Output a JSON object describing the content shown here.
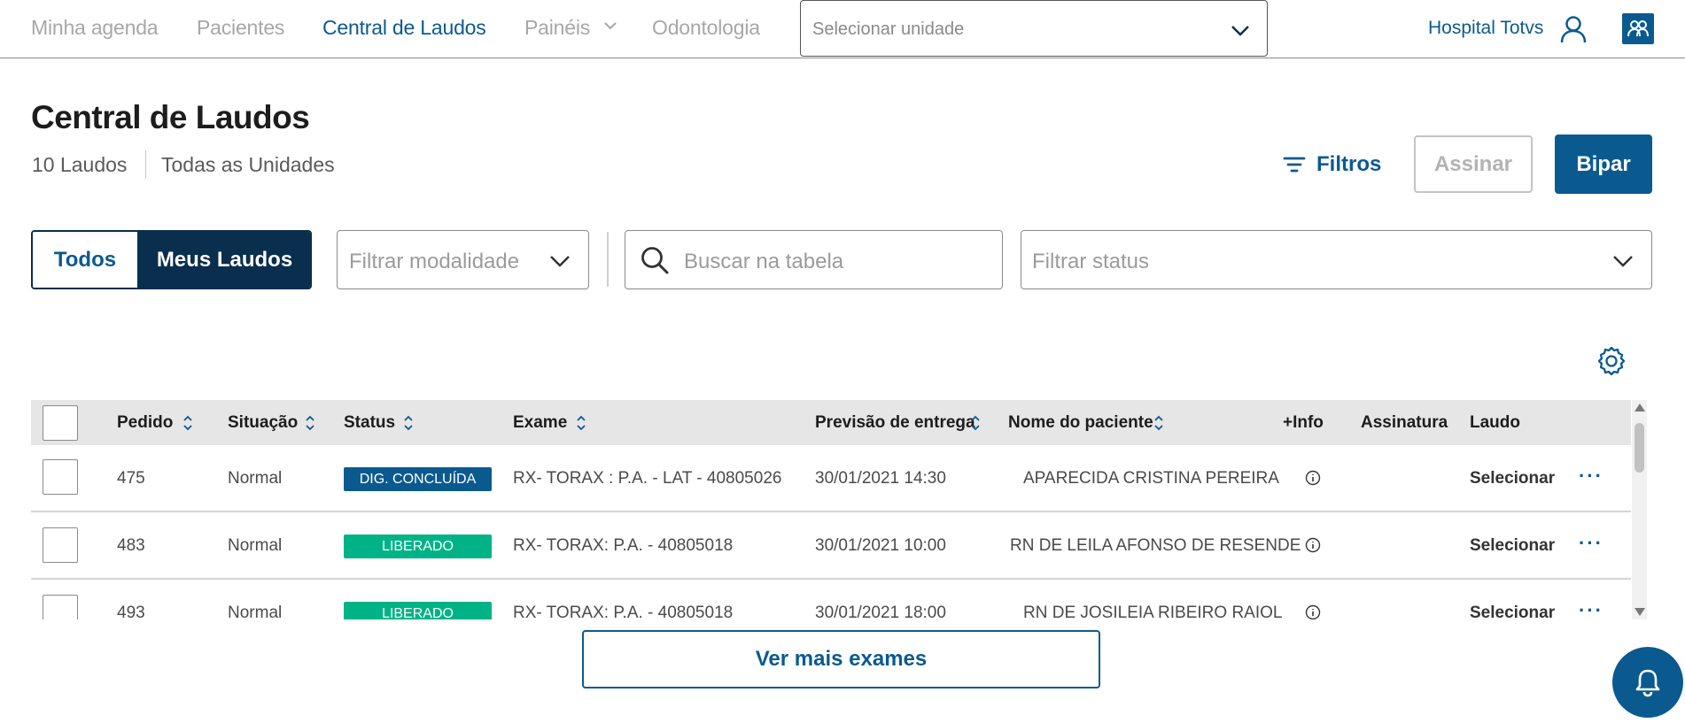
{
  "nav": {
    "items": [
      {
        "label": "Minha agenda",
        "active": false
      },
      {
        "label": "Pacientes",
        "active": false
      },
      {
        "label": "Central de Laudos",
        "active": true
      },
      {
        "label": "Painéis",
        "active": false
      },
      {
        "label": "Odontologia",
        "active": false
      }
    ],
    "unit_select_placeholder": "Selecionar unidade",
    "hospital": "Hospital Totvs",
    "icons": [
      "chevron-down-icon",
      "user-icon",
      "profile-switch-icon"
    ]
  },
  "page": {
    "title": "Central de Laudos",
    "count": "10 Laudos",
    "units": "Todas as Unidades"
  },
  "actions": {
    "filtros": "Filtros",
    "assinar": "Assinar",
    "bipar": "Bipar"
  },
  "filters": {
    "toggle_all": "Todos",
    "toggle_mine": "Meus Laudos",
    "modalidade_placeholder": "Filtrar modalidade",
    "search_placeholder": "Buscar na tabela",
    "status_placeholder": "Filtrar status"
  },
  "table": {
    "columns": [
      "Pedido",
      "Situação",
      "Status",
      "Exame",
      "Previsão de entrega",
      "Nome do paciente",
      "+Info",
      "Assinatura",
      "Laudo"
    ],
    "rows": [
      {
        "pedido": "475",
        "situacao": "Normal",
        "status": "DIG. CONCLUÍDA",
        "status_color": "#0b5a8f",
        "exame": "RX- TORAX : P.A. - LAT - 40805026",
        "previsao": "30/01/2021 14:30",
        "paciente": "APARECIDA CRISTINA PEREIRA",
        "laudo": "Selecionar"
      },
      {
        "pedido": "483",
        "situacao": "Normal",
        "status": "LIBERADO",
        "status_color": "#00b386",
        "exame": "RX- TORAX: P.A. - 40805018",
        "previsao": "30/01/2021 10:00",
        "paciente": "RN DE LEILA AFONSO DE RESENDE",
        "laudo": "Selecionar"
      },
      {
        "pedido": "493",
        "situacao": "Normal",
        "status": "LIBERADO",
        "status_color": "#00b386",
        "exame": "RX- TORAX: P.A. - 40805018",
        "previsao": "30/01/2021 18:00",
        "paciente": "RN DE JOSILEIA RIBEIRO RAIOL",
        "laudo": "Selecionar"
      }
    ]
  },
  "footer": {
    "ver_mais": "Ver mais exames"
  },
  "colors": {
    "primary": "#0b5a8f",
    "dark": "#0a2e4d",
    "success": "#00b386"
  }
}
